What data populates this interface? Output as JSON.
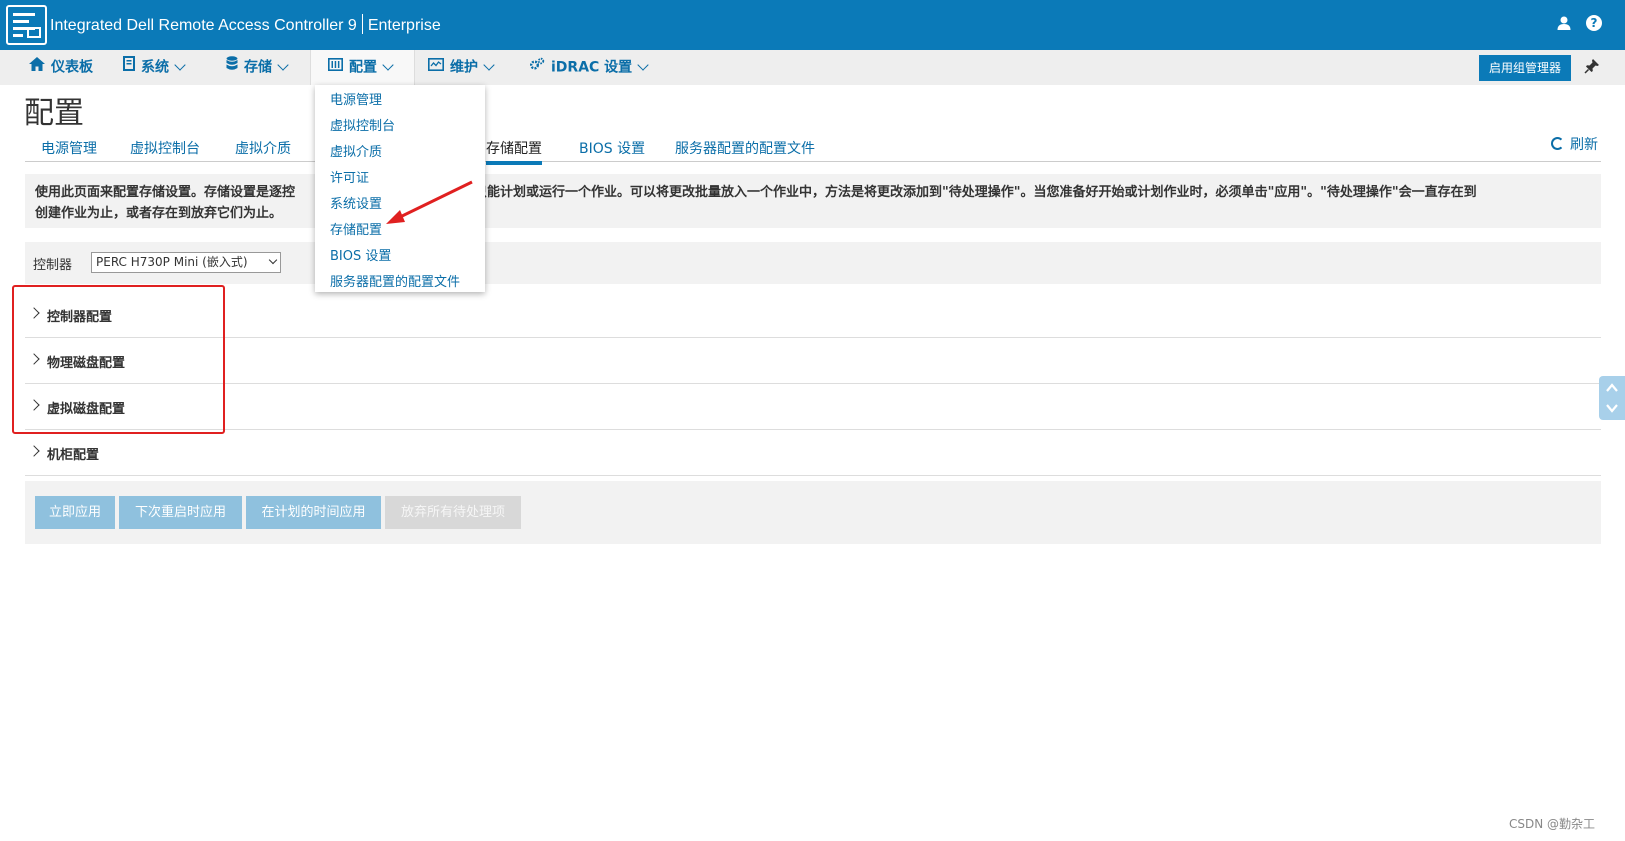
{
  "header": {
    "title": "Integrated Dell Remote Access Controller 9",
    "edition": "Enterprise",
    "user_icon": "user-icon",
    "help_icon": "help-icon",
    "help_symbol": "?"
  },
  "nav": {
    "items": [
      {
        "label": "仪表板",
        "icon": "home-icon"
      },
      {
        "label": "系统",
        "icon": "server-icon"
      },
      {
        "label": "存储",
        "icon": "database-icon"
      },
      {
        "label": "配置",
        "icon": "config-icon"
      },
      {
        "label": "维护",
        "icon": "monitor-icon"
      },
      {
        "label": "iDRAC 设置",
        "icon": "gears-icon"
      }
    ],
    "active": "配置",
    "group_manager_button": "启用组管理器",
    "pin_icon": "pin-icon"
  },
  "dropdown": {
    "items": [
      "电源管理",
      "虚拟控制台",
      "虚拟介质",
      "许可证",
      "系统设置",
      "存储配置",
      "BIOS 设置",
      "服务器配置的配置文件"
    ]
  },
  "page": {
    "title": "配置",
    "tabs": [
      "电源管理",
      "虚拟控制台",
      "虚拟介质",
      "存储配置",
      "BIOS 设置",
      "服务器配置的配置文件"
    ],
    "active_tab": "存储配置",
    "refresh_label": "刷新",
    "info_line1_a": "使用此页面来配置存储设置。存储设置是逐控",
    "info_line1_b": "器一次只能计划或运行一个作业。可以将更改批量放入一个作业中，方法是将更改添加到\"待处理操作\"。当您准备好开始或计划作业时，必须单击\"应用\"。\"待处理操作\"会一直存在到",
    "info_line2": "创建作业为止，或者存在到放弃它们为止。",
    "controller_label": "控制器",
    "controller_value": "PERC H730P Mini (嵌入式)",
    "sections": [
      "控制器配置",
      "物理磁盘配置",
      "虚拟磁盘配置",
      "机柜配置"
    ],
    "buttons": [
      "立即应用",
      "下次重启时应用",
      "在计划的时间应用",
      "放弃所有待处理项"
    ]
  },
  "watermark": "CSDN @勤杂工",
  "colors": {
    "header_blue": "#0b7ab8",
    "link_blue": "#0b6ea8",
    "annotation_red": "#e02020"
  }
}
